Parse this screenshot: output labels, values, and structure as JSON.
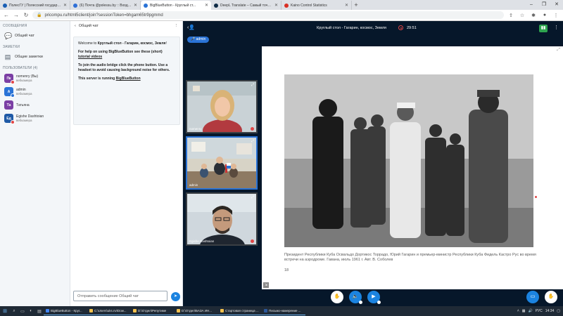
{
  "browser": {
    "tabs": [
      {
        "label": "ПолесГУ | Полесский государст...",
        "color": "#1a5fb4",
        "active": false
      },
      {
        "label": "(6) Почта @polessu.by :: Входящ...",
        "color": "#2f6fd6",
        "active": false
      },
      {
        "label": "BigBlueButton - Круглый ст...",
        "color": "#2a73d6",
        "active": true
      },
      {
        "label": "DeepL Translate – Самый точны...",
        "color": "#0f2b46",
        "active": false
      },
      {
        "label": "Kaino Control Statistics",
        "color": "#d93025",
        "active": false
      }
    ],
    "url": "pricompu.ru/html5client/join?sessionToken=bhgam65tr9pgmmd",
    "window_controls": [
      "–",
      "❐",
      "✕"
    ]
  },
  "userlist": {
    "messages_header": "СООБЩЕНИЯ",
    "public_chat": "Общий чат",
    "notes_header": "ЗАМЕТКИ",
    "shared_notes": "Общие заметки",
    "users_header": "ПОЛЬЗОВАТЕЛИ (4)",
    "users": [
      {
        "initials": "Пк",
        "name": "nomenry (Вы)",
        "sub": "вебкамера",
        "color": "#7b3fa4",
        "mic": "#e04545"
      },
      {
        "initials": "A",
        "name": "admin",
        "sub": "вебкамера",
        "color": "#2a73d6",
        "mic": "#2a73d6"
      },
      {
        "initials": "Та",
        "name": "Татьяна",
        "sub": "",
        "color": "#7b3fa4",
        "mic": ""
      },
      {
        "initials": "Ед",
        "name": "Egishe Dashtoian",
        "sub": "вебкамера",
        "color": "#1f5aa6",
        "mic": "#e04545"
      }
    ]
  },
  "chat": {
    "title": "Общий чат",
    "welcome_line1": "Welcome to ",
    "welcome_title": "Круглый стол - Гагарин, космос, Земля",
    "welcome_line1_end": "!",
    "help_text": "For help on using BigBlueButton see these (short) ",
    "help_link": "tutorial videos",
    "audio_text": "To join the audio bridge click the phone button. Use a headset to avoid causing background noise for others.",
    "server_text": "This server is running ",
    "server_link": "BigBlueButton",
    "input_placeholder": "Отправить сообщение Общий чат"
  },
  "meeting": {
    "title": "Круглый стол - Гагарин, космос, Земля",
    "timer": "29:51",
    "presenter_pill": "admin",
    "videos": [
      {
        "name": "nomenry"
      },
      {
        "name": "admin"
      },
      {
        "name": "Egishe Dashtoian"
      }
    ],
    "slide_caption": "Президент Республики Куба Освальдо Дортикос Торрадо, Юрий Гагарин и премьер-министр Республики Куба Фидель Кастро Рус во время встречи на аэродроме. Гавана, июль 1961 г. Авт. В. Соболев",
    "slide_number": "18"
  },
  "taskbar": {
    "apps": [
      {
        "label": "BigBlueButton - Круг...",
        "color": "#4285f4"
      },
      {
        "label": "C:\\Users\\uks.nv\\Dow...",
        "color": "#f2c14e"
      },
      {
        "label": "D:\\Отдел\\Репутиме",
        "color": "#f2c14e"
      },
      {
        "label": "D:\\Отдел\\БАЗА ИН...",
        "color": "#f2c14e"
      },
      {
        "label": "Стартовая страница ...",
        "color": "#f2c14e"
      },
      {
        "label": "Письмо-намерение ...",
        "color": "#2b579a"
      }
    ],
    "lang": "РУС",
    "time": "14:34"
  }
}
